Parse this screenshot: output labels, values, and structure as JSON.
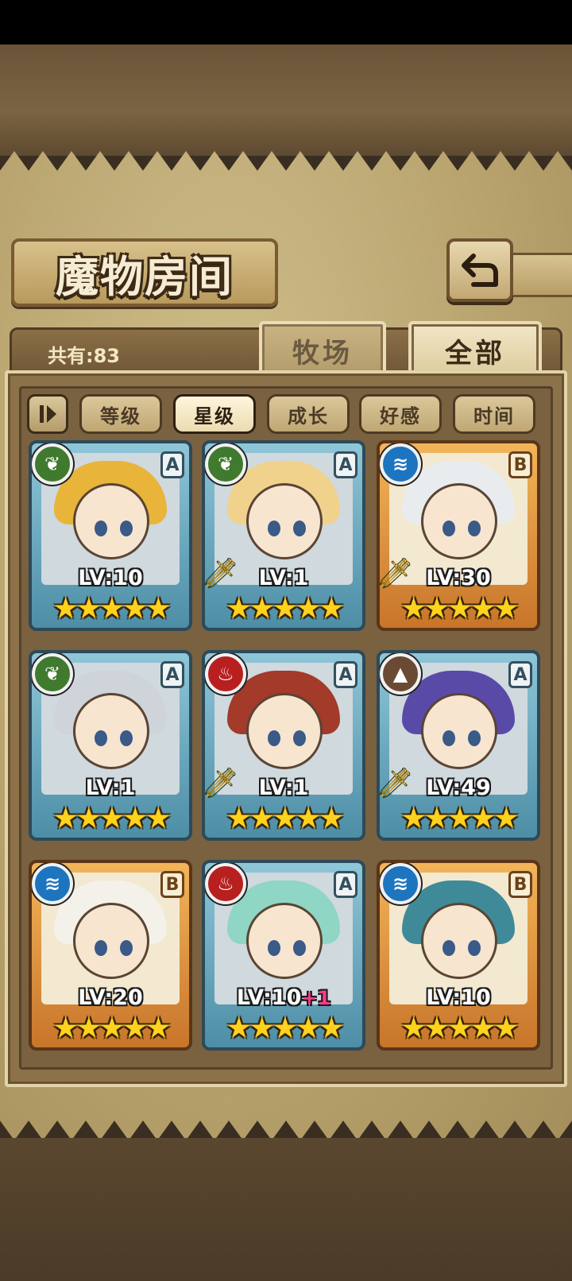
{
  "page": {
    "title": "魔物房间",
    "count_label": "共有:83",
    "tabs": [
      {
        "label": "牧场",
        "active": false
      },
      {
        "label": "全部",
        "active": true
      }
    ]
  },
  "sort_bar": {
    "toggle_icon": "⏸",
    "options": [
      {
        "label": "等级",
        "selected": false
      },
      {
        "label": "星级",
        "selected": true
      },
      {
        "label": "成长",
        "selected": false
      },
      {
        "label": "好感",
        "selected": false
      },
      {
        "label": "时间",
        "selected": false
      }
    ]
  },
  "monsters": [
    {
      "element": "nature",
      "element_icon": "❦",
      "rank": "A",
      "frame": "blue",
      "level": "LV:10",
      "bonus": "",
      "weapon": false,
      "stars": 5,
      "hair": "#e9b43a"
    },
    {
      "element": "nature",
      "element_icon": "❦",
      "rank": "A",
      "frame": "blue",
      "level": "LV:1",
      "bonus": "",
      "weapon": true,
      "stars": 5,
      "hair": "#f1d28c"
    },
    {
      "element": "water",
      "element_icon": "≋",
      "rank": "B",
      "frame": "gold",
      "level": "LV:30",
      "bonus": "",
      "weapon": true,
      "stars": 5,
      "hair": "#e8ecef"
    },
    {
      "element": "nature",
      "element_icon": "❦",
      "rank": "A",
      "frame": "blue",
      "level": "LV:1",
      "bonus": "",
      "weapon": false,
      "stars": 5,
      "hair": "#cfd3da"
    },
    {
      "element": "fire",
      "element_icon": "♨",
      "rank": "A",
      "frame": "blue",
      "level": "LV:1",
      "bonus": "",
      "weapon": true,
      "stars": 5,
      "hair": "#a33a2a"
    },
    {
      "element": "earth",
      "element_icon": "▲",
      "rank": "A",
      "frame": "blue",
      "level": "LV:49",
      "bonus": "",
      "weapon": true,
      "stars": 5,
      "hair": "#5a4aa8"
    },
    {
      "element": "water",
      "element_icon": "≋",
      "rank": "B",
      "frame": "gold",
      "level": "LV:20",
      "bonus": "",
      "weapon": false,
      "stars": 5,
      "hair": "#f4f1ea"
    },
    {
      "element": "fire",
      "element_icon": "♨",
      "rank": "A",
      "frame": "blue",
      "level": "LV:10",
      "bonus": "+1",
      "weapon": false,
      "stars": 5,
      "hair": "#8fd6c4"
    },
    {
      "element": "water",
      "element_icon": "≋",
      "rank": "B",
      "frame": "gold",
      "level": "LV:10",
      "bonus": "",
      "weapon": false,
      "stars": 5,
      "hair": "#3e8a98"
    }
  ],
  "colors": {
    "nature": "#3f7a2e",
    "water": "#1d74bf",
    "fire": "#b81f1f",
    "earth": "#6b4a33",
    "star": "#ffd21e",
    "level_bonus": "#ff3a8a"
  },
  "icons": {
    "back_button": "↶"
  }
}
